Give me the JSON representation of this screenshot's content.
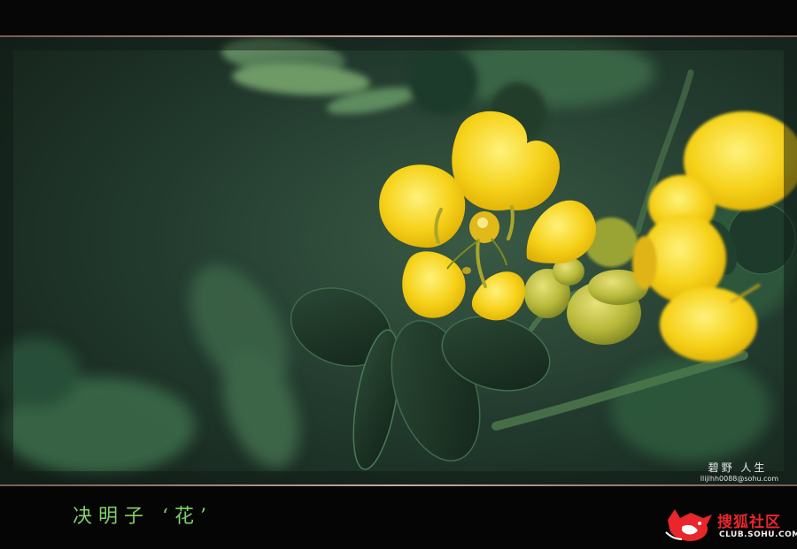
{
  "caption": "决明子 ‘花’",
  "signature": "碧野 人生",
  "credit": "llijlhh0088@sohu.com",
  "logo": {
    "brand": "搜狐社区",
    "domain": "CLUB.SOHU.COM",
    "icon": "fox-icon"
  },
  "colors": {
    "caption": "#7fd06a",
    "petal": "#f6d21a",
    "leaf": "#1f3a2a",
    "brand_red": "#e8262c"
  }
}
